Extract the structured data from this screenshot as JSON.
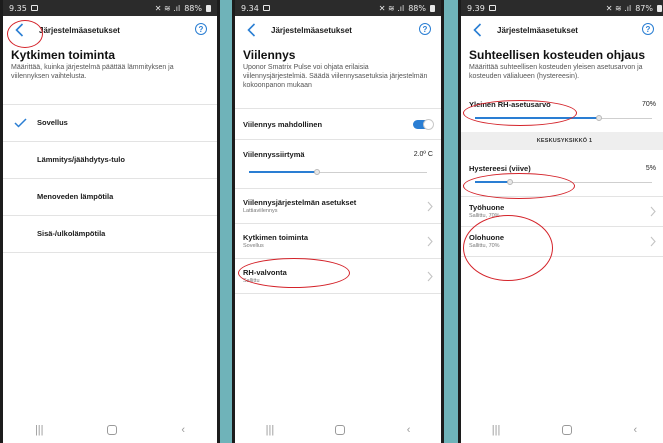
{
  "colors": {
    "accent": "#2a7ed3",
    "annotation": "#d4232a",
    "background": "#6fb3b9"
  },
  "icons": {
    "back": "chevron-left-icon",
    "help": "question-circle-icon",
    "check": "check-icon",
    "chevron": "chevron-right-icon"
  },
  "screen1": {
    "status": {
      "time": "9.35",
      "right": "88%"
    },
    "title": "Järjestelmäasetukset",
    "help": "?",
    "heading": "Kytkimen toiminta",
    "desc": "Määrittää, kuinka järjestelmä päättää lämmityksen ja viilennyksen vaihtelusta.",
    "items": [
      {
        "label": "Sovellus",
        "selected": true
      },
      {
        "label": "Lämmitys/jäähdytys-tulo",
        "selected": false
      },
      {
        "label": "Menoveden lämpötila",
        "selected": false
      },
      {
        "label": "Sisä-/ulkolämpötila",
        "selected": false
      }
    ]
  },
  "screen2": {
    "status": {
      "time": "9.34",
      "right": "88%"
    },
    "title": "Järjestelmäasetukset",
    "help": "?",
    "heading": "Viilennys",
    "desc": "Uponor Smatrix Pulse voi ohjata erilaisia viilennysjärjestelmiä. Säädä viilennysasetuksia järjestelmän kokoonpanon mukaan",
    "cooling_enabled_label": "Viilennys mahdollinen",
    "cooling_enabled": true,
    "offset_label": "Viilennyssiirtymä",
    "offset_value": "2.0º C",
    "offset_slider": 0.38,
    "items": [
      {
        "label": "Viilennysjärjestelmän asetukset",
        "sub": "Lattiaviilennys"
      },
      {
        "label": "Kytkimen toiminta",
        "sub": "Sovellus"
      },
      {
        "label": "RH-valvonta",
        "sub": "Sallittu"
      }
    ]
  },
  "screen3": {
    "status": {
      "time": "9.39",
      "right": "87%"
    },
    "title": "Järjestelmäasetukset",
    "help": "?",
    "heading": "Suhteellisen kosteuden ohjaus",
    "desc": "Määrittää suhteellisen kosteuden yleisen asetusarvon ja kosteuden välialueen (hystereesin).",
    "rh_label": "Yleinen RH-asetusarvo",
    "rh_value": "70%",
    "rh_slider": 0.7,
    "section": "KESKUSYKSIKKÖ 1",
    "hyst_label": "Hystereesi (viive)",
    "hyst_value": "5%",
    "hyst_slider": 0.2,
    "rooms": [
      {
        "label": "Työhuone",
        "sub": "Sallittu, 70%"
      },
      {
        "label": "Olohuone",
        "sub": "Sallittu, 70%"
      }
    ]
  }
}
